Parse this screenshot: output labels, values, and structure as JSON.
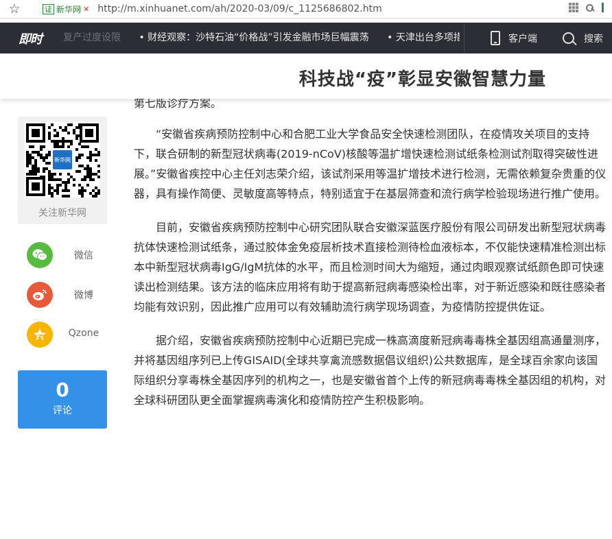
{
  "browser": {
    "cert_badge": "证",
    "cert_name": "新华网",
    "cert_warning": "✕",
    "url": "http://m.xinhuanet.com/ah/2020-03/09/c_1125686802.htm"
  },
  "nav": {
    "logo": "即时",
    "ticker": [
      "复产过度设限",
      "• 财经观察：沙特石油“价格战”引发金融市场巨幅震荡",
      "• 天津出台多项措施"
    ],
    "client_label": "客户端",
    "search_label": "搜索"
  },
  "header": {
    "title": "科技战“疫”彰显安徽智慧力量"
  },
  "sidebar": {
    "qr_caption": "关注新华网",
    "qr_center_label": "新华网",
    "share": [
      {
        "label": "微信",
        "icon": "wechat-icon",
        "color": "#57bb3f"
      },
      {
        "label": "微博",
        "icon": "weibo-icon",
        "color": "#e65a3a"
      },
      {
        "label": "Qzone",
        "icon": "qzone-icon",
        "color": "#f7b500"
      }
    ],
    "comments": {
      "count": "0",
      "label": "评论"
    }
  },
  "article": {
    "paragraphs": [
      "第七版诊疗方案。",
      "“安徽省疾病预防控制中心和合肥工业大学食品安全快速检测团队，在疫情攻关项目的支持下，联合研制的新型冠状病毒(2019-nCoV)核酸等温扩增快速检测试纸条检测试剂取得突破性进展。”安徽省疾控中心主任刘志荣介绍，该试剂采用等温扩增技术进行检测，无需依赖复杂贵重的仪器，具有操作简便、灵敏度高等特点，特别适宜于在基层筛查和流行病学检验现场进行推广使用。",
      "目前，安徽省疾病预防控制中心研究团队联合安徽深蓝医疗股份有限公司研发出新型冠状病毒抗体快速检测试纸条，通过胶体金免疫层析技术直接检测待检血液标本，不仅能快速精准检测出标本中新型冠状病毒IgG/IgM抗体的水平，而且检测时间大为缩短，通过肉眼观察试纸颜色即可快速读出检测结果。该方法的临床应用将有助于提高新冠病毒感染检出率，对于新近感染和既往感染者均能有效识别，因此推广应用可以有效辅助流行病学现场调查，为疫情防控提供佐证。",
      "据介绍，安徽省疾病预防控制中心近期已完成一株高滴度新冠病毒毒株全基因组高通量测序，并将基因组序列已上传GISAID(全球共享禽流感数据倡议组织)公共数据库，是全球百余家向该国际组织分享毒株全基因序列的机构之一，也是安徽省首个上传的新冠病毒毒株全基因组的机构，对全球科研团队更全面掌握病毒演化和疫情防控产生积极影响。"
    ]
  },
  "colors": {
    "navbar_bg": "#2b2e35",
    "comment_bg": "#3591e8",
    "wechat": "#57bb3f",
    "weibo": "#e65a3a",
    "qzone": "#f7b500"
  }
}
